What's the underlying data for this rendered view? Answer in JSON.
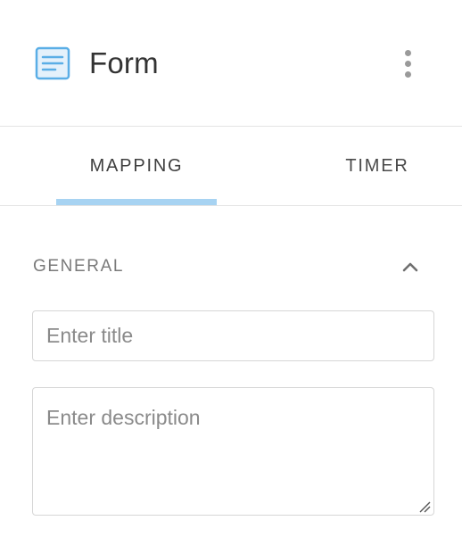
{
  "header": {
    "title": "Form",
    "icon": "form-document-icon",
    "menu_icon": "more-vertical-icon",
    "icon_color": "#5aaee6"
  },
  "tabs": [
    {
      "label": "MAPPING",
      "active": true
    },
    {
      "label": "TIMER",
      "active": false
    }
  ],
  "accent_color": "#a7d3f2",
  "section": {
    "title": "GENERAL",
    "expanded": true,
    "toggle_icon": "chevron-up-icon"
  },
  "fields": {
    "title": {
      "value": "",
      "placeholder": "Enter title"
    },
    "description": {
      "value": "",
      "placeholder": "Enter description"
    }
  }
}
